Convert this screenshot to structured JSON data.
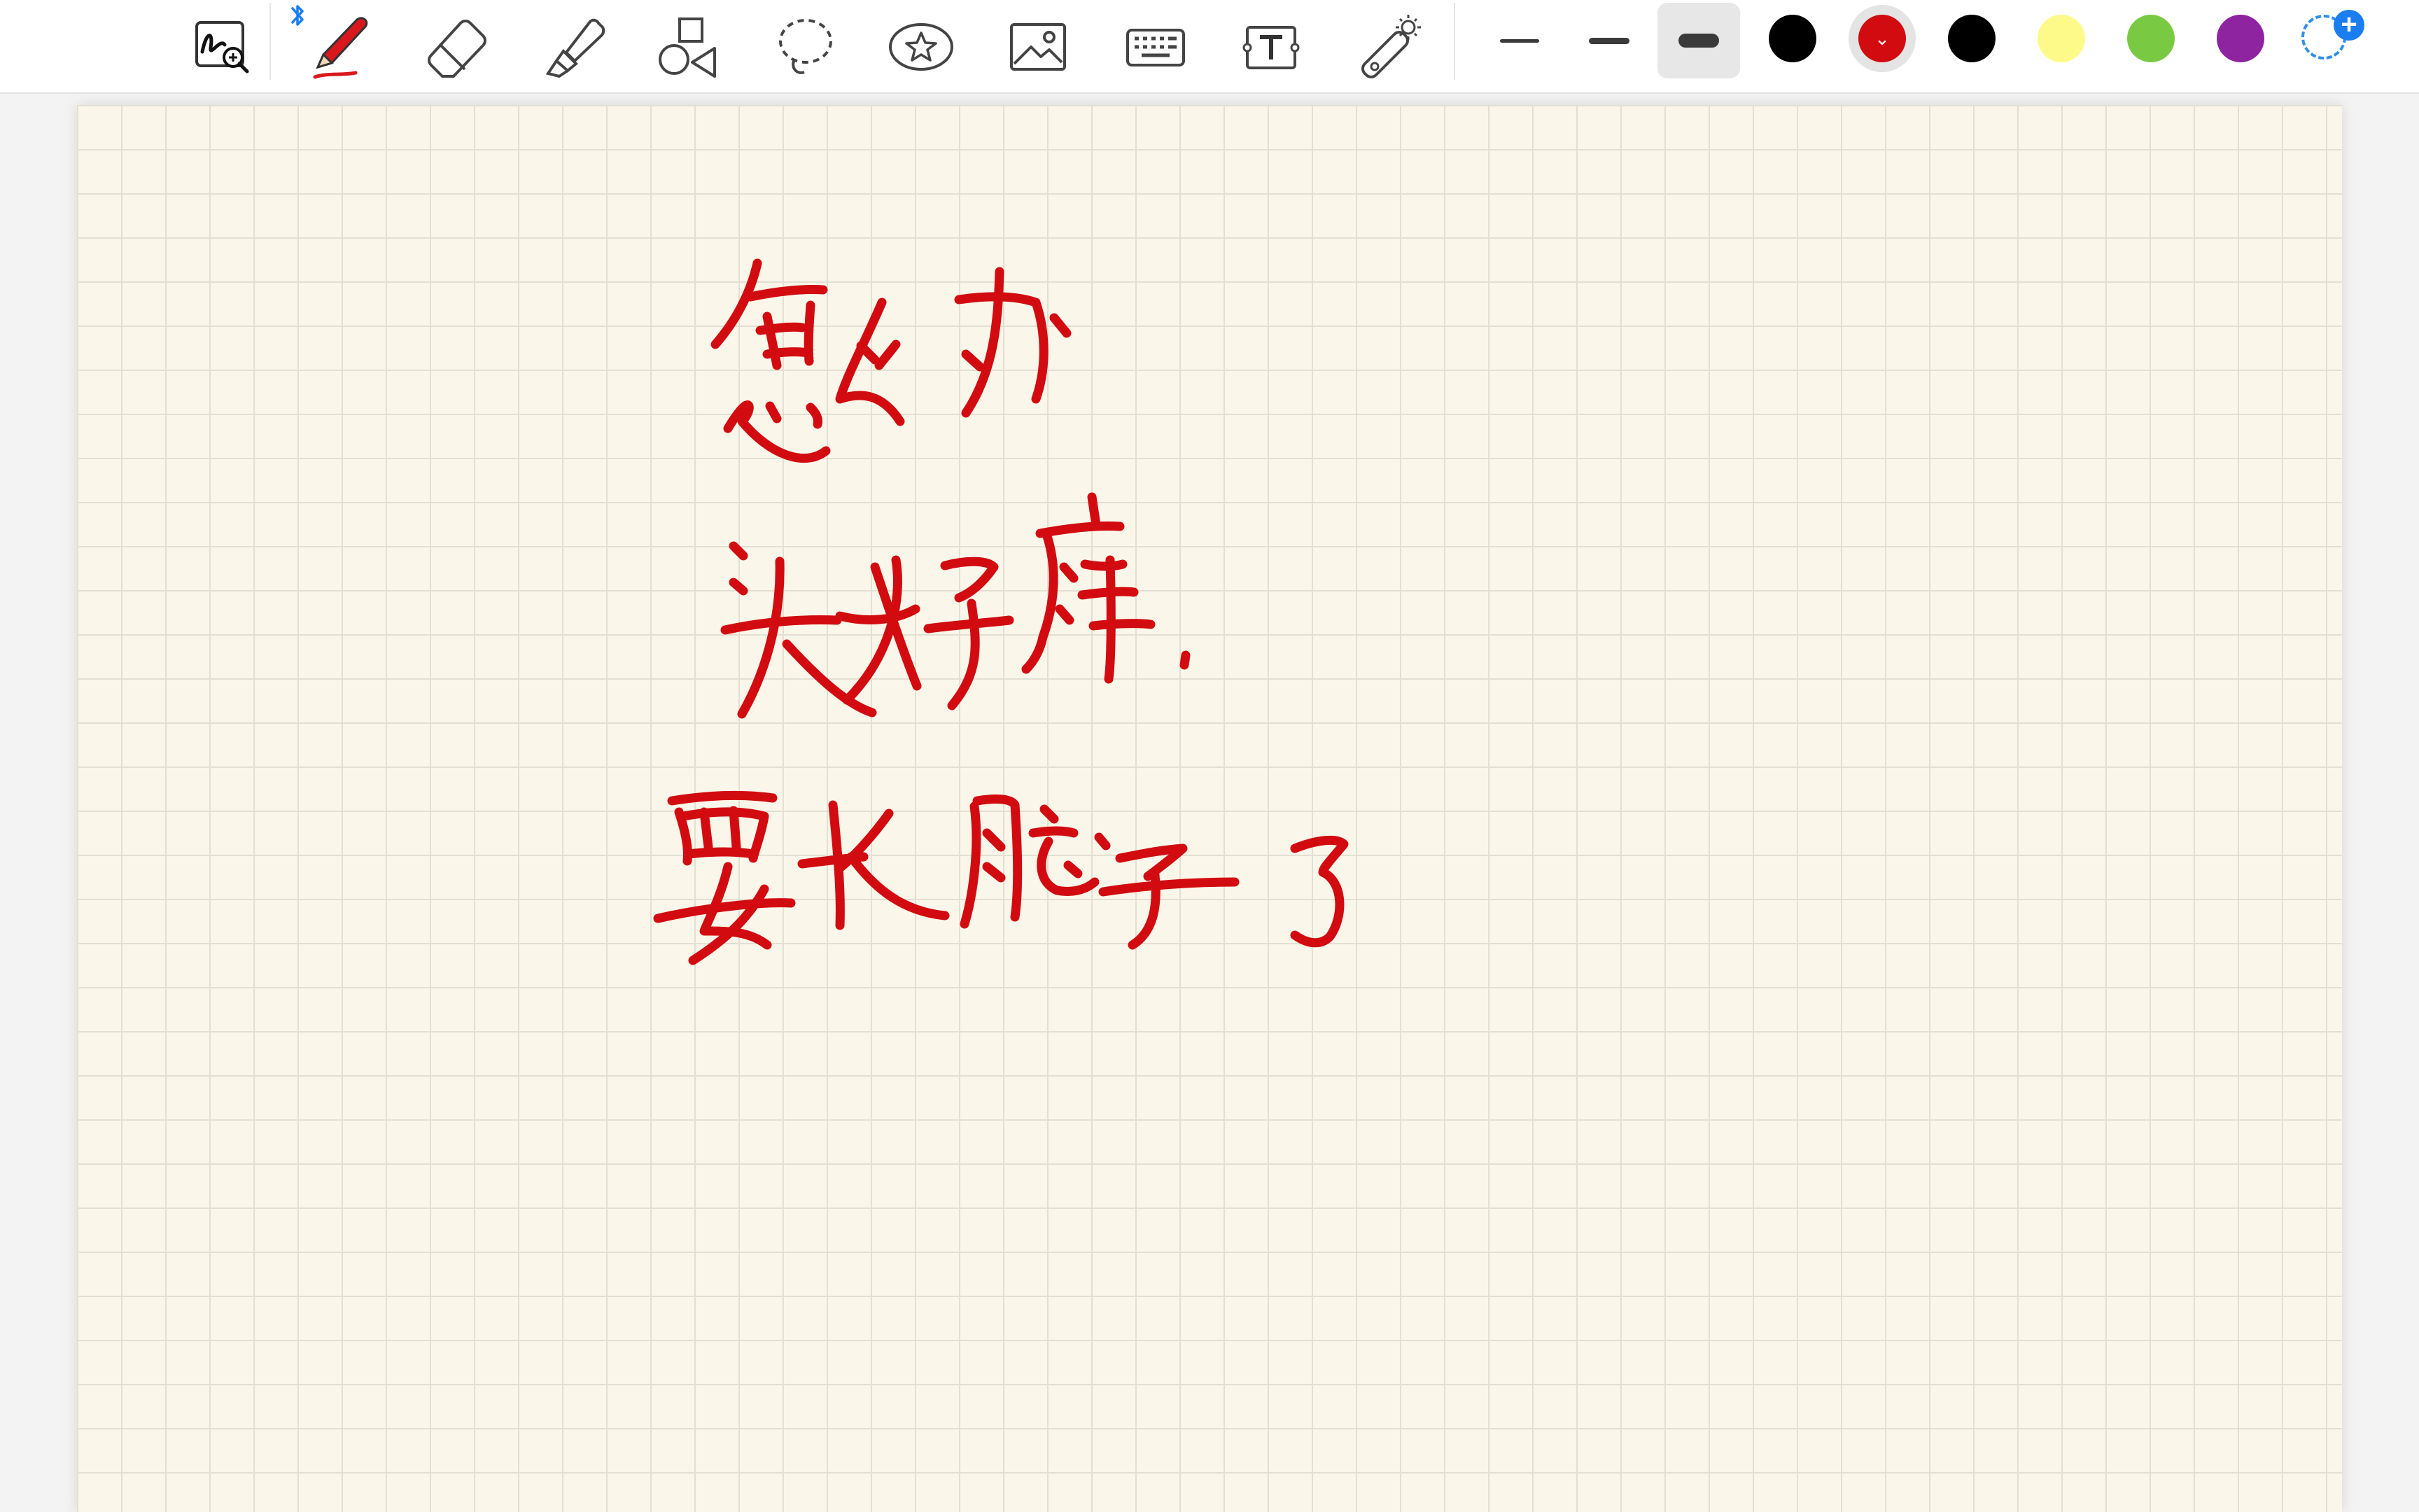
{
  "toolbar": {
    "tools": [
      {
        "name": "zoom-window-icon"
      },
      {
        "name": "pen-icon",
        "selected": true
      },
      {
        "name": "eraser-icon"
      },
      {
        "name": "highlighter-icon"
      },
      {
        "name": "shapes-icon"
      },
      {
        "name": "lasso-icon"
      },
      {
        "name": "sticker-icon"
      },
      {
        "name": "image-icon"
      },
      {
        "name": "keyboard-icon"
      },
      {
        "name": "text-box-icon"
      },
      {
        "name": "laser-pointer-icon"
      }
    ],
    "bluetooth_icon": "bluetooth-icon",
    "stroke_widths": [
      "thin",
      "medium",
      "thick"
    ],
    "selected_stroke_width": "thick",
    "colors": [
      "#000000",
      "#d20b10",
      "#000000",
      "#fdfa8a",
      "#7ac943",
      "#8e24a0"
    ],
    "selected_color": "#d20b10",
    "custom_color_icon": "add-color-icon"
  },
  "page": {
    "background": "#faf7ea",
    "grid_color": "#e3e0d3",
    "ink_color": "#d20b10",
    "handwriting_lines": [
      "怎么办",
      "头好痒.",
      "要长脑子了"
    ]
  }
}
